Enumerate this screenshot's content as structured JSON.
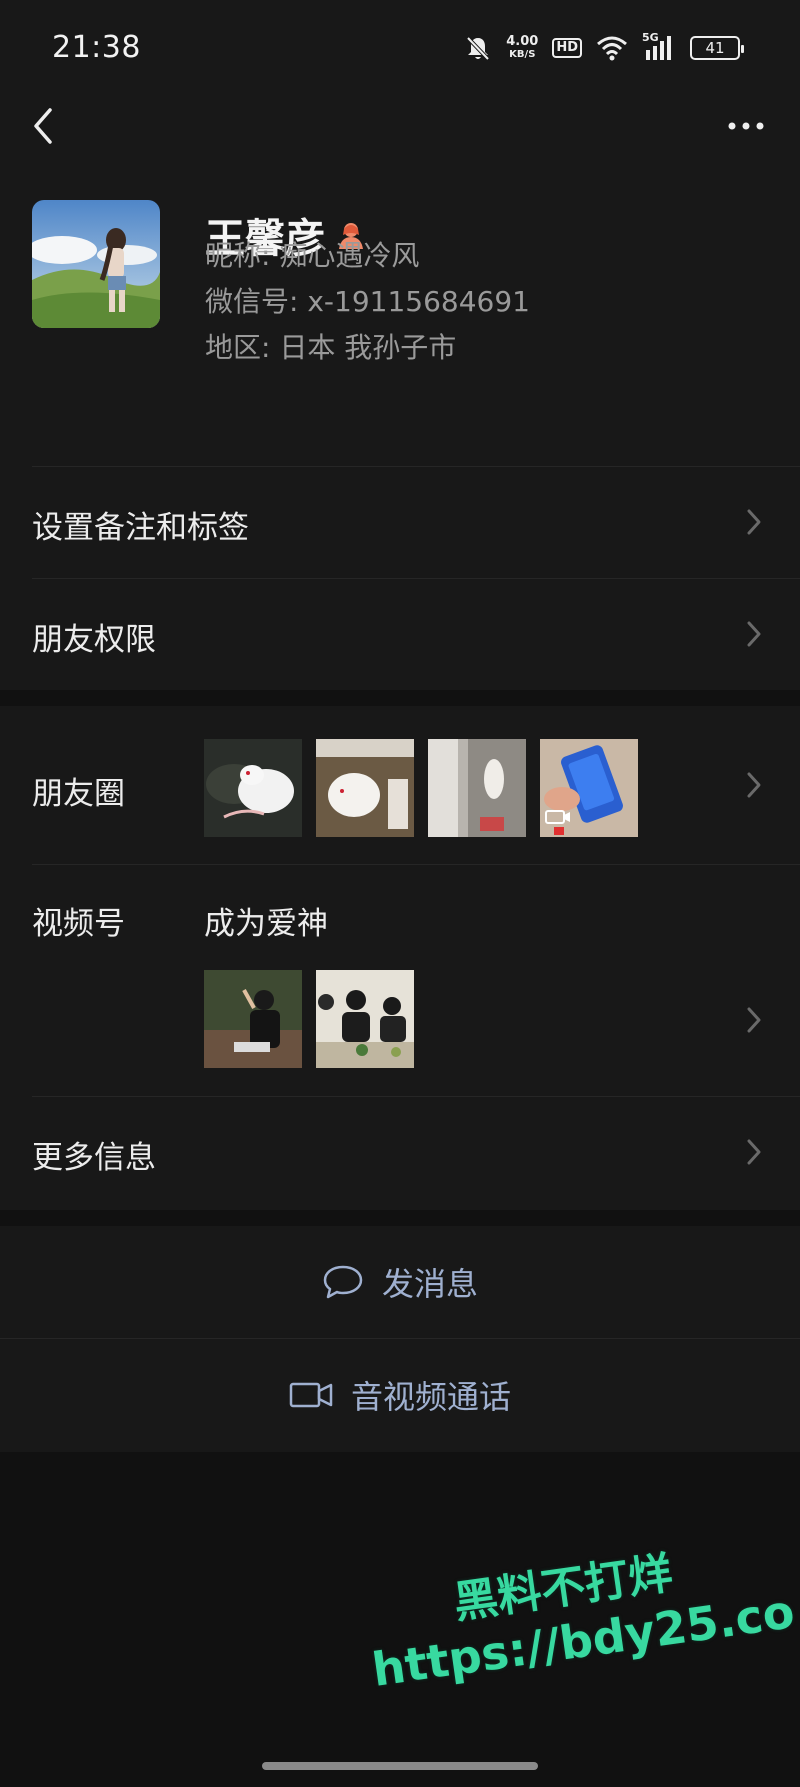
{
  "status_bar": {
    "time": "21:38",
    "net_speed_value": "4.00",
    "net_speed_unit": "KB/S",
    "hd_label": "HD",
    "signal_label": "5G",
    "battery": "41"
  },
  "profile": {
    "name": "王馨彦",
    "nickname": "昵称: 痴心遇冷风",
    "wechat_id": "微信号: x-19115684691",
    "region": "地区: 日本  我孙子市"
  },
  "menu": {
    "remark_label": "设置备注和标签",
    "permissions_label": "朋友权限"
  },
  "moments": {
    "label": "朋友圈"
  },
  "channels": {
    "label": "视频号",
    "title": "成为爱神"
  },
  "more_info": {
    "label": "更多信息"
  },
  "actions": {
    "message": "发消息",
    "call": "音视频通话"
  },
  "watermark": {
    "line1": "黑料不打烊",
    "line2": "https://bdy25.co"
  },
  "colors": {
    "background": "#111111",
    "card": "#181818",
    "action_text": "#9fb0d0",
    "watermark": "#38d9a0"
  }
}
